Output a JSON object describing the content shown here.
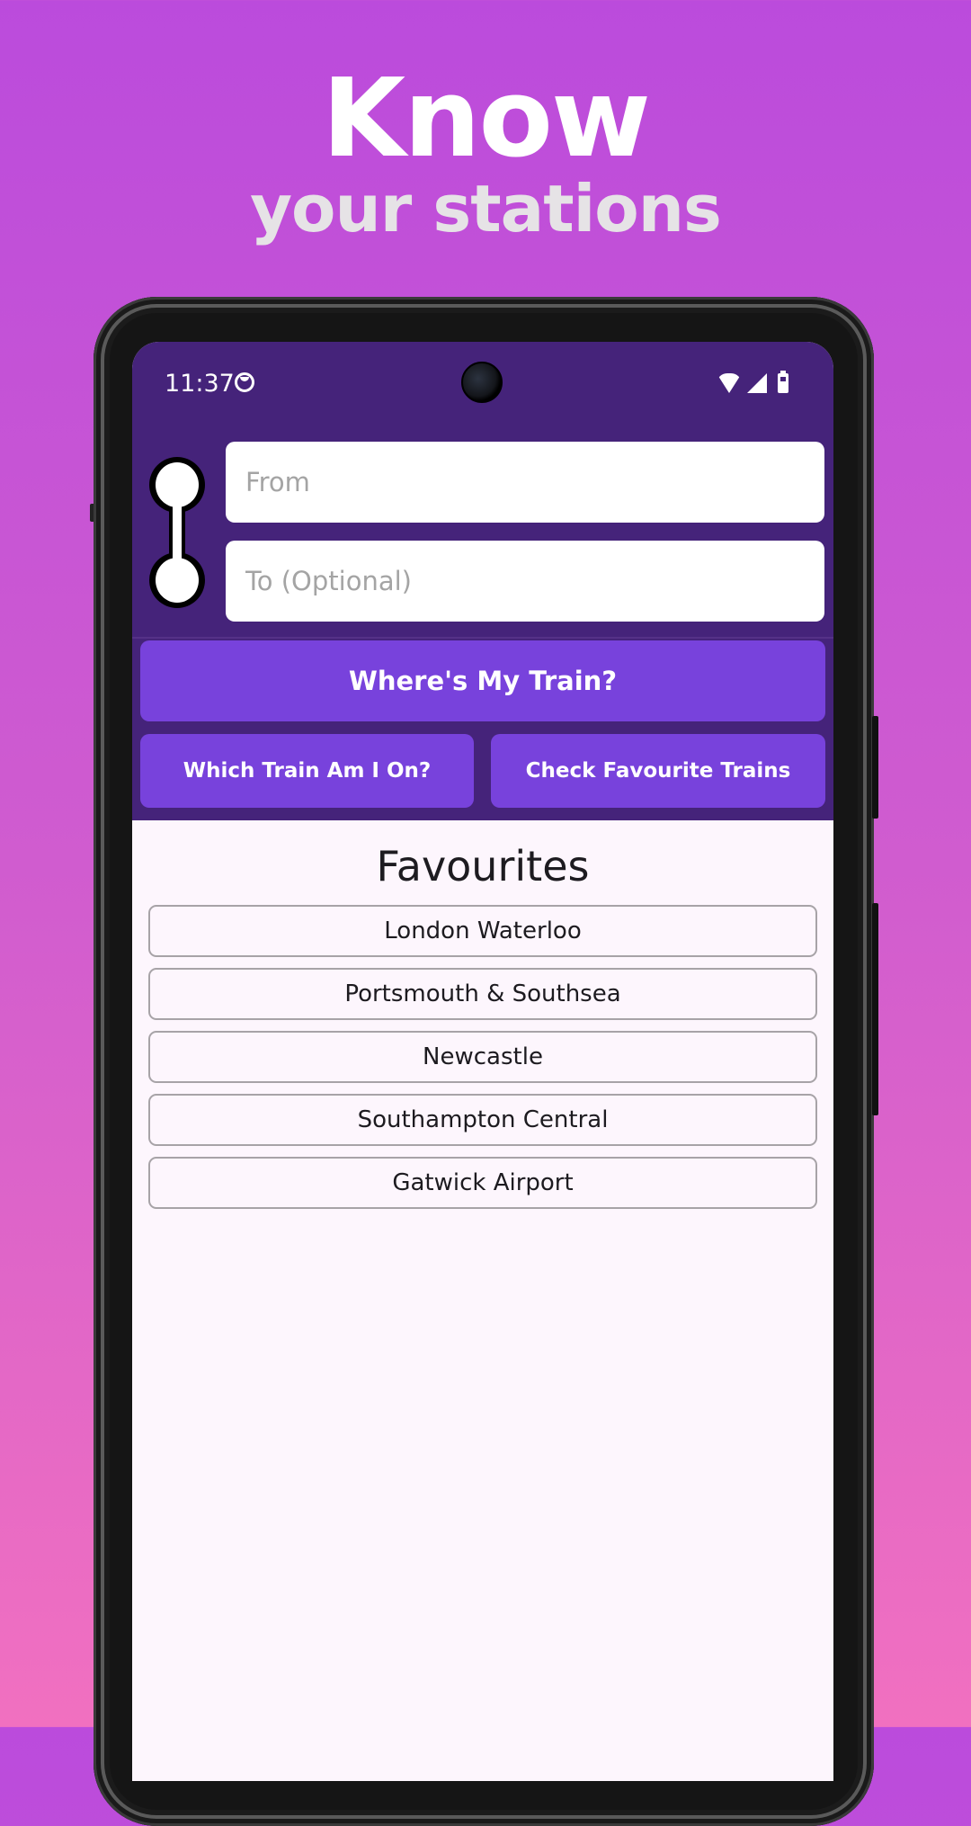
{
  "promo": {
    "headline": "Know",
    "subheadline": "your stations"
  },
  "status_bar": {
    "time": "11:37",
    "icons": [
      "app-notification-icon",
      "wifi-icon",
      "signal-icon",
      "battery-icon"
    ]
  },
  "search": {
    "from_placeholder": "From",
    "from_value": "",
    "to_placeholder": "To (Optional)",
    "to_value": ""
  },
  "actions": {
    "primary_label": "Where's My Train?",
    "which_train_label": "Which Train Am I On?",
    "check_favourites_label": "Check Favourite Trains"
  },
  "favourites": {
    "title": "Favourites",
    "items": [
      "London Waterloo",
      "Portsmouth & Southsea",
      "Newcastle",
      "Southampton Central",
      "Gatwick Airport"
    ]
  },
  "colors": {
    "header_bg": "#45237a",
    "button_bg": "#7842dc",
    "content_bg": "#fdf6fd"
  }
}
